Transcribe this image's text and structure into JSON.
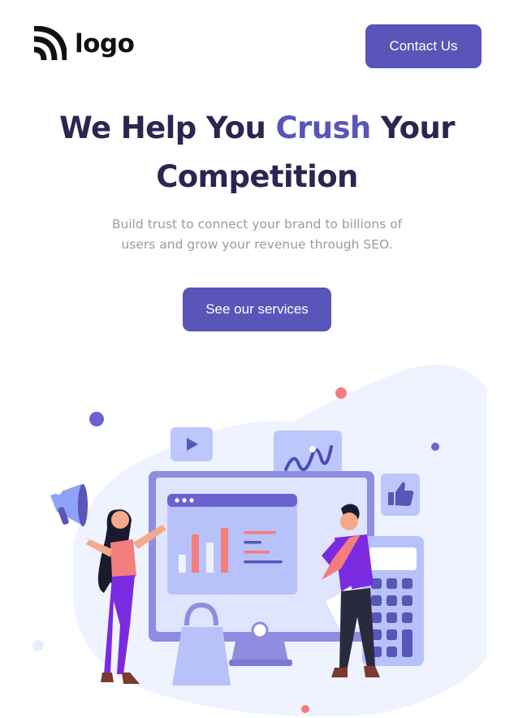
{
  "header": {
    "logo_text": "logo",
    "contact_label": "Contact Us"
  },
  "hero": {
    "title_part1": "We Help You ",
    "title_accent": "Crush",
    "title_part2": " Your",
    "title_line2": "Competition",
    "subtitle": "Build trust to connect your brand to billions of users and grow your revenue through SEO.",
    "cta_label": "See our services"
  },
  "colors": {
    "brand": "#5a55b8",
    "heading": "#2b2650",
    "muted_text": "#9a9aa6",
    "illustration_bg": "#eef3ff"
  },
  "illustration": {
    "icons": [
      "play-icon",
      "trend-chart-icon",
      "thumbs-up-icon",
      "bar-chart-icon",
      "calculator-icon",
      "megaphone-icon",
      "shopping-bag-icon"
    ]
  }
}
